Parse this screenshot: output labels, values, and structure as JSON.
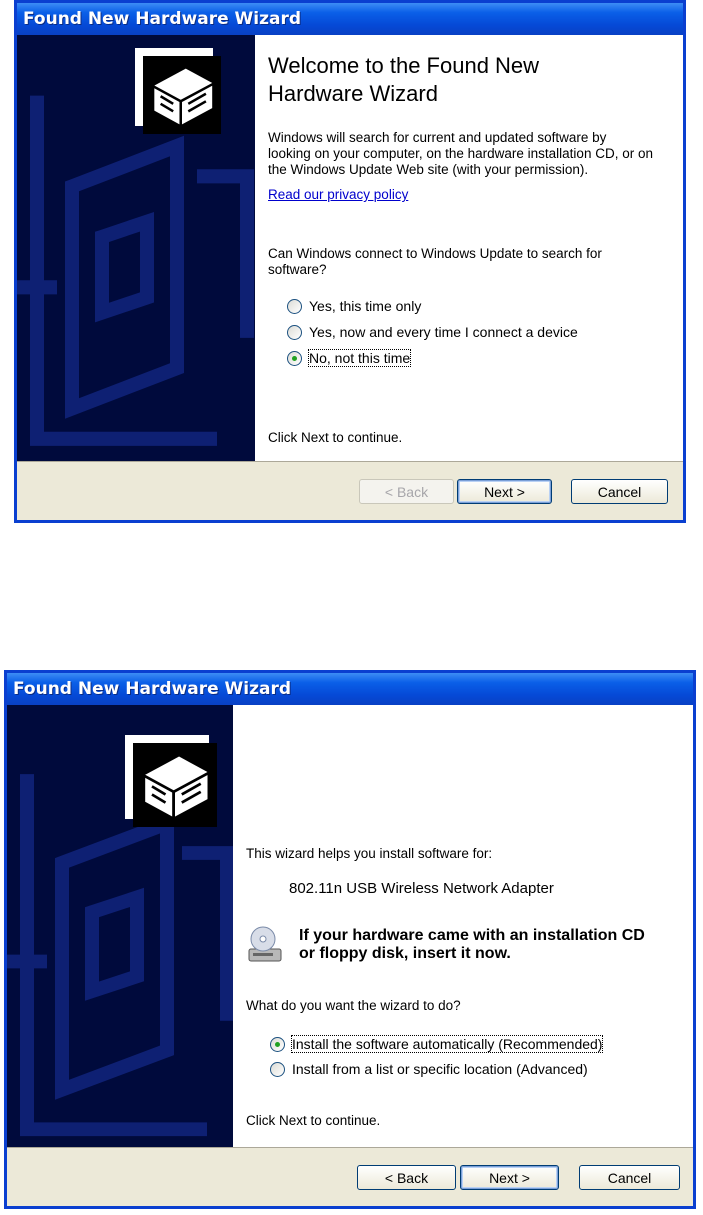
{
  "dialog1": {
    "title": "Found New Hardware Wizard",
    "heading_line1": "Welcome to the Found New",
    "heading_line2": "Hardware Wizard",
    "intro_line1": "Windows will search for current and updated software by",
    "intro_line2": "looking on your computer, on the hardware installation CD, or on",
    "intro_line3": "the Windows Update Web site (with your permission).",
    "privacy_link": "Read our privacy policy",
    "question_line1": "Can Windows connect to Windows Update to search for",
    "question_line2": "software?",
    "options": [
      {
        "label": "Yes, this time only",
        "selected": false
      },
      {
        "label": "Yes, now and every time I connect a device",
        "selected": false
      },
      {
        "label": "No, not this time",
        "selected": true
      }
    ],
    "footer_text": "Click Next to continue.",
    "buttons": {
      "back": "< Back",
      "next": "Next >",
      "cancel": "Cancel"
    },
    "back_disabled": true
  },
  "dialog2": {
    "title": "Found New Hardware Wizard",
    "intro": "This wizard helps you install software for:",
    "device": "802.11n USB Wireless Network Adapter",
    "cd_line1": "If your hardware came with an installation CD",
    "cd_line2": "or floppy disk, insert it now.",
    "question": "What do you want the wizard to do?",
    "options": [
      {
        "label": "Install the software automatically (Recommended)",
        "selected": true
      },
      {
        "label": "Install from a list or specific location (Advanced)",
        "selected": false
      }
    ],
    "footer_text": "Click Next to continue.",
    "buttons": {
      "back": "< Back",
      "next": "Next >",
      "cancel": "Cancel"
    }
  },
  "colors": {
    "titlebar": "#0549d6",
    "sidebar": "#000a3c",
    "frame": "#ece9d8",
    "radio_dot": "#21a121"
  },
  "icons": [
    "hardware-wizard-icon",
    "cd-drive-icon"
  ]
}
